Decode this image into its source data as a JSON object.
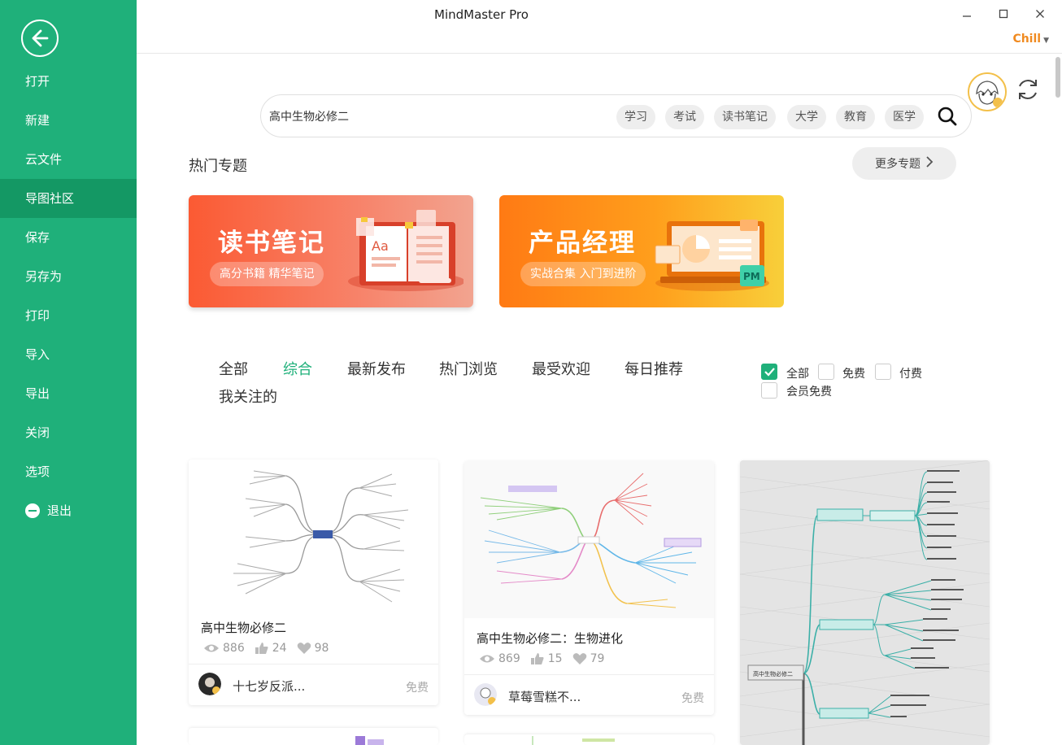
{
  "app": {
    "title": "MindMaster Pro",
    "user": "Chill"
  },
  "sidebar": {
    "items": [
      {
        "label": "打开"
      },
      {
        "label": "新建"
      },
      {
        "label": "云文件"
      },
      {
        "label": "导图社区"
      },
      {
        "label": "保存"
      },
      {
        "label": "另存为"
      },
      {
        "label": "打印"
      },
      {
        "label": "导入"
      },
      {
        "label": "导出"
      },
      {
        "label": "关闭"
      },
      {
        "label": "选项"
      },
      {
        "label": "退出"
      }
    ],
    "active": "导图社区"
  },
  "search": {
    "value": "高中生物必修二",
    "tags": [
      "学习",
      "考试",
      "读书笔记",
      "大学",
      "教育",
      "医学"
    ]
  },
  "topics": {
    "title": "热门专题",
    "more": "更多专题",
    "banners": [
      {
        "title": "读书笔记",
        "subtitle": "高分书籍 精华笔记"
      },
      {
        "title": "产品经理",
        "subtitle": "实战合集 入门到进阶",
        "badge": "PM"
      }
    ]
  },
  "tabs": [
    "全部",
    "综合",
    "最新发布",
    "热门浏览",
    "最受欢迎",
    "每日推荐",
    "我关注的"
  ],
  "active_tab": "综合",
  "filters": [
    {
      "label": "全部",
      "checked": true
    },
    {
      "label": "免费",
      "checked": false
    },
    {
      "label": "付费",
      "checked": false
    },
    {
      "label": "会员免费",
      "checked": false
    }
  ],
  "cards": [
    {
      "title": "高中生物必修二",
      "views": "886",
      "likes": "24",
      "favs": "98",
      "author": "十七岁反派...",
      "price": "免费"
    },
    {
      "title": "高中生物必修二：生物进化",
      "views": "869",
      "likes": "15",
      "favs": "79",
      "author": "草莓雪糕不...",
      "price": "免费"
    },
    {
      "thumb_root": "高中生物必修二"
    }
  ],
  "colors": {
    "brand": "#1fb07a",
    "brand_dark": "#149864",
    "accent": "#f08a20"
  }
}
